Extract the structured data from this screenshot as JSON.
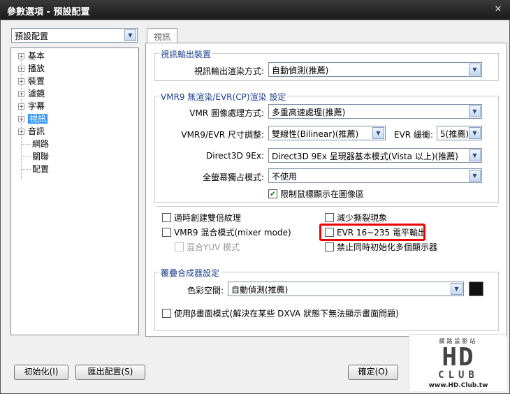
{
  "window": {
    "title": "參數選項 - 預設配置",
    "close_glyph": "✕"
  },
  "profile_combo": {
    "value": "預設配置"
  },
  "tree": {
    "items": [
      {
        "label": "基本",
        "expandable": true
      },
      {
        "label": "播放",
        "expandable": true
      },
      {
        "label": "裝置",
        "expandable": true
      },
      {
        "label": "濾鏡",
        "expandable": true
      },
      {
        "label": "字幕",
        "expandable": true
      },
      {
        "label": "視訊",
        "expandable": true,
        "selected": true
      },
      {
        "label": "音訊",
        "expandable": true
      },
      {
        "label": "網路",
        "expandable": false
      },
      {
        "label": "關聯",
        "expandable": false
      },
      {
        "label": "配置",
        "expandable": false
      }
    ]
  },
  "tab": {
    "label": "視訊"
  },
  "output_group": {
    "title": "視訊輸出裝置",
    "render_label": "視訊輸出渲染方式:",
    "render_value": "自動偵測(推薦)"
  },
  "vmr9_group": {
    "title": "VMR9 無渲染/EVR(CP)渲染 設定",
    "image_label": "VMR 圖像處理方式:",
    "image_value": "多重高速處理(推薦)",
    "resize_label": "VMR9/EVR 尺寸調整:",
    "resize_value": "雙線性(Bilinear)(推薦)",
    "evr_buffer_label": "EVR 緩衝:",
    "evr_buffer_value": "5(推薦)",
    "d3d_label": "Direct3D 9Ex:",
    "d3d_value": "Direct3D 9Ex 呈現器基本模式(Vista 以上)(推薦)",
    "fullscreen_label": "全螢幕獨占模式:",
    "fullscreen_value": "不使用",
    "limit_mouse": {
      "label": "限制鼠標顯示在圖像區",
      "checked": true
    }
  },
  "options": {
    "double_texture": {
      "label": "適時創建雙倍紋理",
      "checked": false
    },
    "mixer_mode": {
      "label": "VMR9 混合模式(mixer mode)",
      "checked": false
    },
    "mix_yuv": {
      "label": "混合YUV 模式",
      "checked": false
    },
    "reduce_tearing": {
      "label": "減少撕裂現象",
      "checked": false
    },
    "evr_range": {
      "label": "EVR 16~235 電平輸出",
      "checked": false
    },
    "no_multi_monitor": {
      "label": "禁止同時初始化多個顯示器",
      "checked": false
    }
  },
  "overlay_group": {
    "title": "覆疊合成器設定",
    "colorspace_label": "色彩空間:",
    "colorspace_value": "自動偵測(推薦)",
    "swatch_color": "#111111",
    "beta_mode": {
      "label": "使用β畫面模式(解決在某些 DXVA 狀態下無法顯示畫面問題)",
      "checked": false
    }
  },
  "buttons": {
    "init": "初始化(I)",
    "export": "匯出配置(S)",
    "ok": "確定(O)"
  },
  "watermark": {
    "top": "網路設影站",
    "main": "HD",
    "sub": "CLUB",
    "url": "www.HD.Club.tw"
  },
  "colors": {
    "highlight": "#e00000",
    "group_title": "#1a3f8f",
    "selection": "#3399ff"
  }
}
